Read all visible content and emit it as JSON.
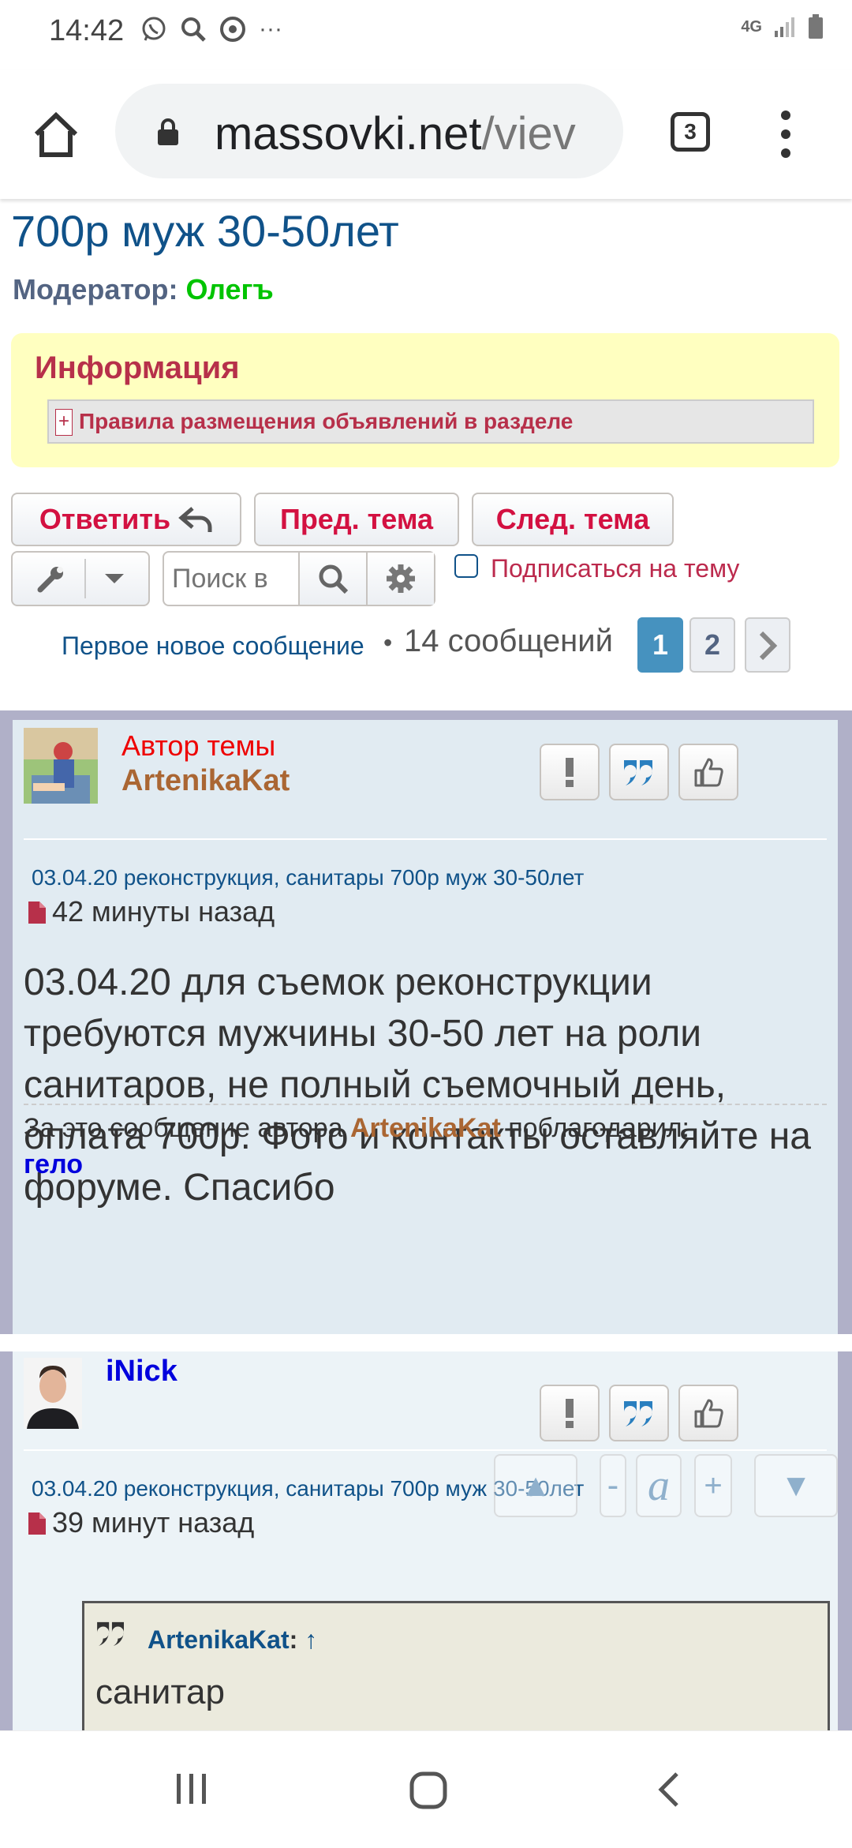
{
  "status_bar": {
    "time": "14:42",
    "network": "4G",
    "icons": [
      "whatsapp-icon",
      "search-icon",
      "chrome-icon",
      "more-icon"
    ]
  },
  "browser": {
    "url_main": "massovki.net",
    "url_rest": "/viev",
    "tab_count": "3"
  },
  "topic": {
    "title": "700р муж 30-50лет",
    "moderator_label": "Модератор:",
    "moderator_name": "Олегъ"
  },
  "info": {
    "title": "Информация",
    "plus": "+",
    "rule_text": "Правила размещения объявлений в разделе"
  },
  "buttons": {
    "reply": "Ответить",
    "prev_topic": "Пред. тема",
    "next_topic": "След. тема",
    "search_placeholder": "Поиск в",
    "subscribe": "Подписаться на тему"
  },
  "pagination": {
    "first_new": "Первое новое сообщение",
    "bullet": "•",
    "count": "14 сообщений",
    "pages": [
      "1",
      "2"
    ],
    "current": "1"
  },
  "posts": [
    {
      "author_label": "Автор темы",
      "author": "ArtenikaKat",
      "subject": "03.04.20 реконструкция, санитары 700р муж 30-50лет",
      "time": "42 минуты назад",
      "body": "03.04.20 для съемок реконструкции требуются мужчины 30-50 лет на роли санитаров, не полный съемочный день, оплата 700р. Фото и контакты оставляйте на форуме. Спасибо",
      "thanks_prefix": "За это сообщение автора ",
      "thanks_author": "ArtenikaKat",
      "thanks_suffix": " поблагодарил:",
      "thanks_user": "гело"
    },
    {
      "author": "iNick",
      "subject": "03.04.20 реконструкция, санитары 700р муж 30-50лет",
      "time": "39 минут назад",
      "quote_author": "ArtenikaKat",
      "quote_colon": ":",
      "quote_arrow": "↑",
      "quote_text": "санитар"
    }
  ],
  "float_controls": {
    "up": "▲",
    "minus": "-",
    "font": "a",
    "plus": "+",
    "down": "▼"
  },
  "colors": {
    "link": "#105289",
    "red_button": "#d31141",
    "author": "#aa6633",
    "moderator": "#00c400",
    "post_bg": "#e1ebf2"
  }
}
